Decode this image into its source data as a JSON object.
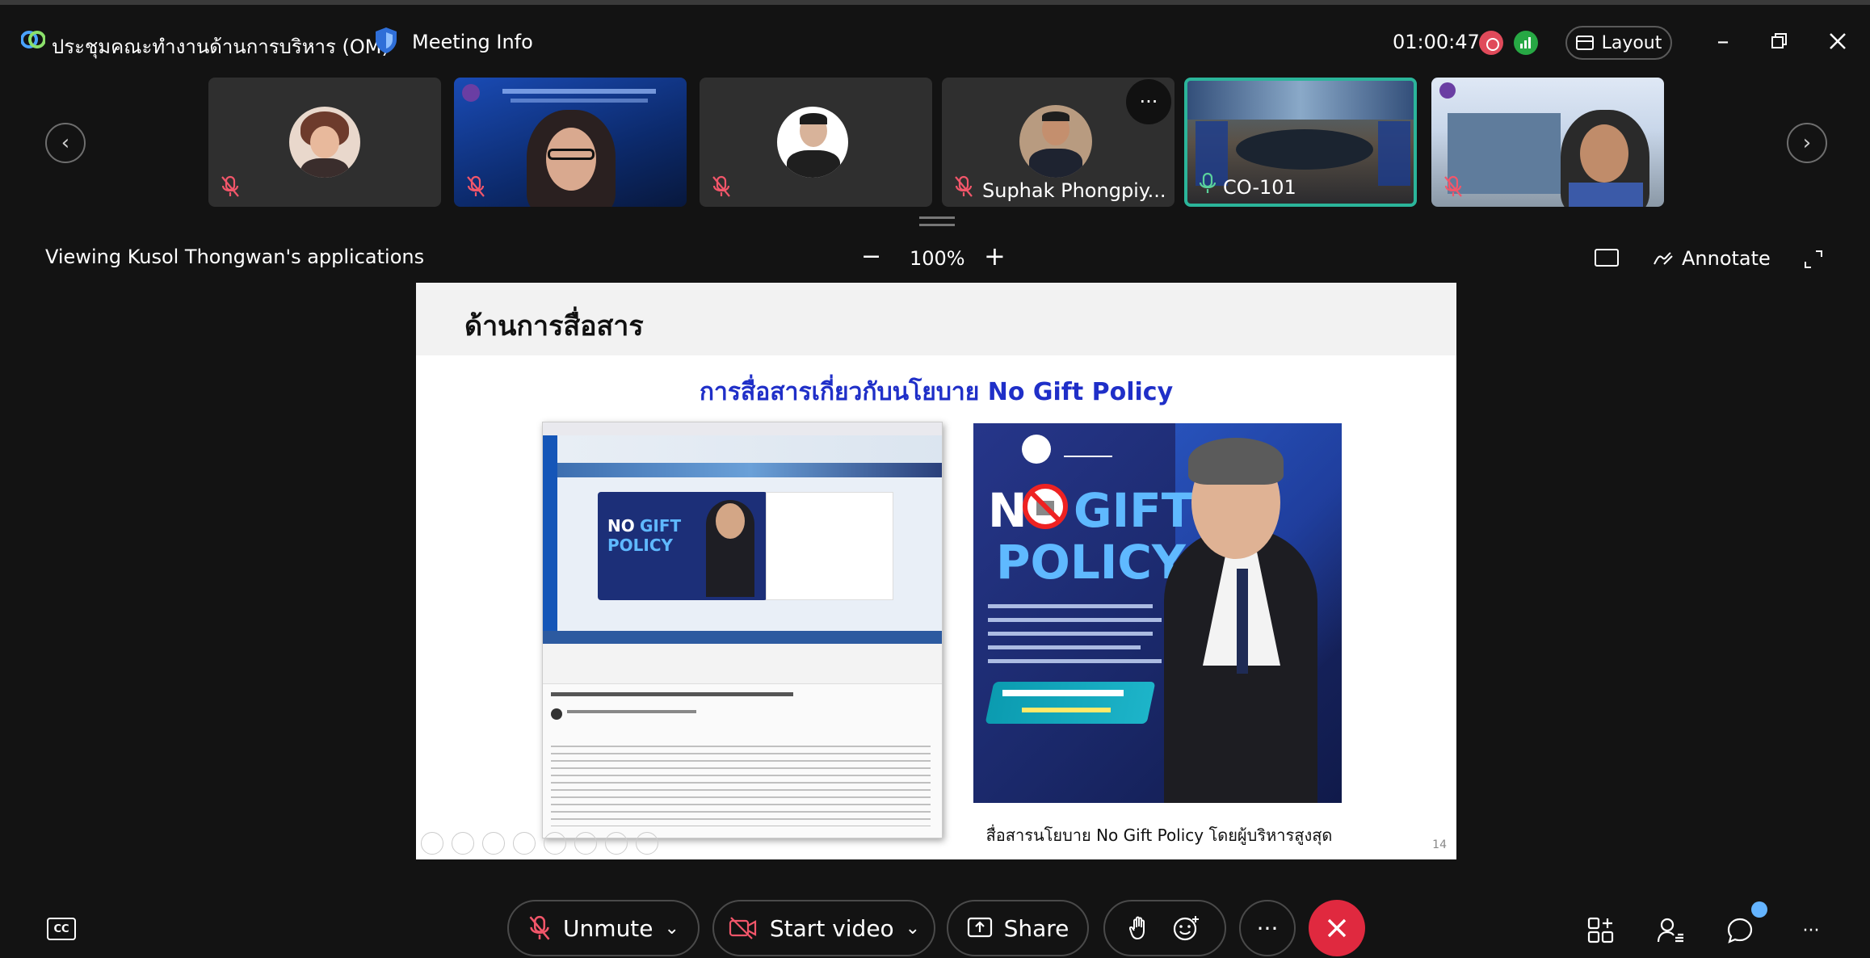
{
  "titlebar": {
    "meeting_title": "ประชุมคณะทำงานด้านการบริหาร (OM)",
    "meeting_info": "Meeting Info",
    "timer": "01:00:47",
    "layout_label": "Layout"
  },
  "thumbnails": [
    {
      "name": "",
      "muted": true
    },
    {
      "name": "",
      "muted": true
    },
    {
      "name": "",
      "muted": true
    },
    {
      "name": "Suphak Phongpiy...",
      "muted": true
    },
    {
      "name": "CO-101",
      "muted": false
    },
    {
      "name": "",
      "muted": true
    }
  ],
  "share": {
    "viewing_label": "Viewing Kusol Thongwan's applications",
    "zoom_minus": "−",
    "zoom_level": "100%",
    "zoom_plus": "+",
    "annotate_label": "Annotate"
  },
  "slide": {
    "heading": "ด้านการสื่อสาร",
    "subtitle": "การสื่อสารเกี่ยวกับนโยบาย No Gift Policy",
    "poster_caption": "สื่อสารนโยบาย No Gift Policy โดยผู้บริหารสูงสุด",
    "page_number": "14"
  },
  "controls": {
    "cc_label": "CC",
    "unmute_label": "Unmute",
    "start_video_label": "Start video",
    "share_label": "Share",
    "more_label": "···"
  },
  "colors": {
    "background": "#131313",
    "accent_teal": "#2bb59a",
    "end_call": "#e0293f",
    "record": "#e04a5a",
    "signal": "#27a844",
    "slide_title_blue": "#1f2fc8",
    "notification": "#64b4ff"
  }
}
